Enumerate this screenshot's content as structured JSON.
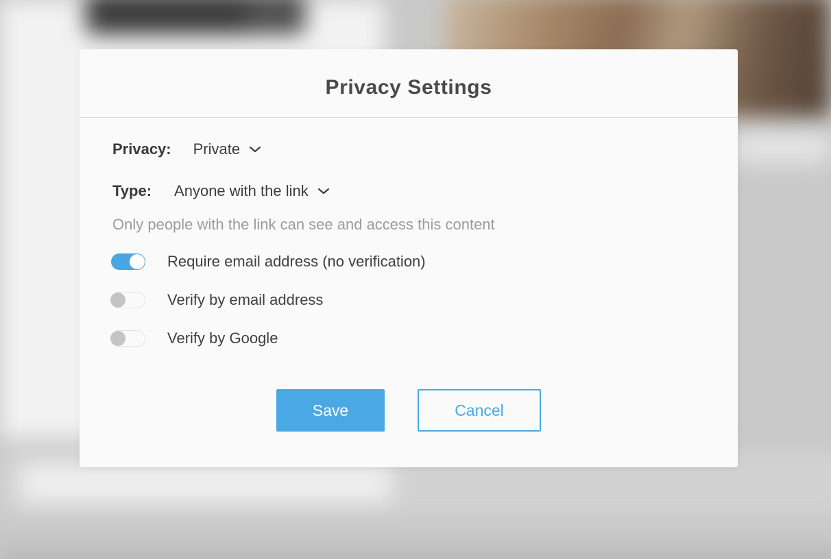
{
  "modal": {
    "title": "Privacy Settings"
  },
  "privacy": {
    "label": "Privacy:",
    "value": "Private",
    "icon": "chevron-down-icon"
  },
  "type": {
    "label": "Type:",
    "value": "Anyone with the link",
    "icon": "chevron-down-icon",
    "description": "Only people with the link can see and access this content"
  },
  "options": [
    {
      "label": "Require email address (no verification)",
      "enabled": true
    },
    {
      "label": "Verify by email address",
      "enabled": false
    },
    {
      "label": "Verify by Google",
      "enabled": false
    }
  ],
  "buttons": {
    "save_label": "Save",
    "cancel_label": "Cancel"
  },
  "colors": {
    "accent": "#4aa9e4",
    "toggle_on": "#4aa6e1",
    "toggle_off_knob": "#c4c4c4",
    "muted_text": "#9b9b9b"
  }
}
